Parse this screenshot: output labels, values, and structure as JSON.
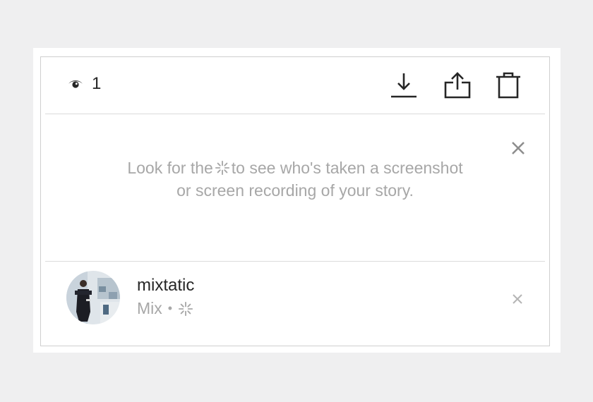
{
  "header": {
    "viewer_count": "1"
  },
  "notice": {
    "text_before": "Look for the",
    "text_after": "to see who's taken a screenshot or screen recording of your story."
  },
  "viewer": {
    "username": "mixtatic",
    "name": "Mix",
    "separator": "•"
  },
  "icons": {
    "views": "eye-icon",
    "download": "download-icon",
    "share": "share-icon",
    "delete": "trash-icon",
    "close": "close-icon",
    "screenshot": "screenshot-burst-icon"
  },
  "colors": {
    "text_primary": "#262626",
    "text_secondary": "#a7a7a7",
    "divider": "#dbdbdb",
    "background": "#efeff0"
  }
}
